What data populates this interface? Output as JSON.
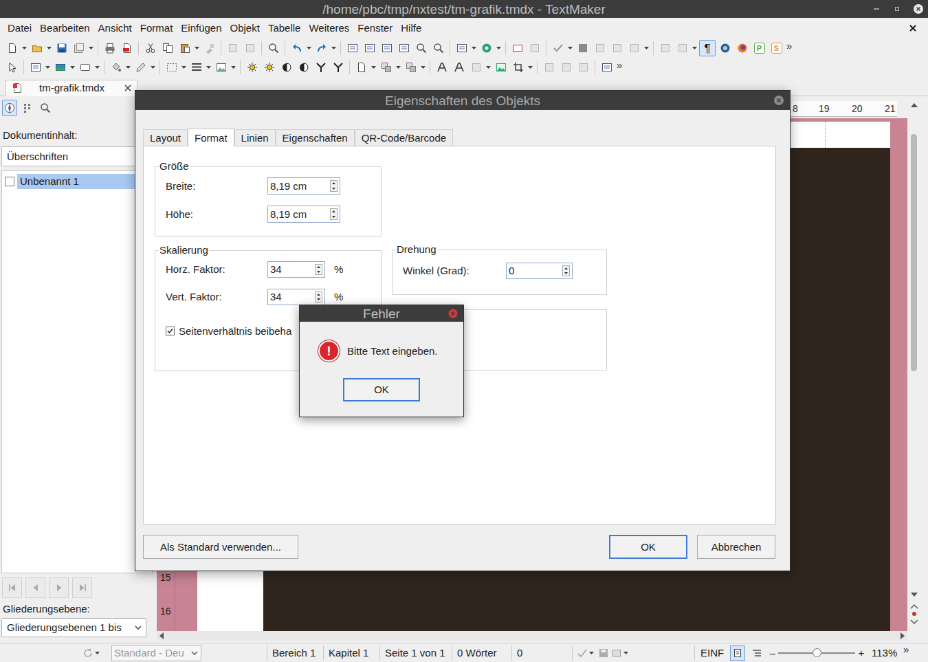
{
  "window": {
    "title": "/home/pbc/tmp/nxtest/tm-grafik.tmdx - TextMaker"
  },
  "menu": {
    "items": [
      "Datei",
      "Bearbeiten",
      "Ansicht",
      "Format",
      "Einfügen",
      "Objekt",
      "Tabelle",
      "Weiteres",
      "Fenster",
      "Hilfe"
    ]
  },
  "toolbar": {
    "pilcrow": {
      "text": "¶",
      "active": true
    },
    "letters": [
      {
        "text": "P",
        "color": "#5aa83c"
      },
      {
        "text": "S",
        "color": "#f0961a"
      }
    ],
    "overflow": "»"
  },
  "toolbar2": {
    "overflow": "»"
  },
  "document_tabs": [
    {
      "label": "tm-grafik.tmdx",
      "selected": true
    }
  ],
  "sidebar": {
    "tabs": [
      {
        "selected": true
      },
      {
        "selected": false
      },
      {
        "selected": false
      }
    ],
    "content_label": "Dokumentinhalt:",
    "filter": "Überschriften",
    "items": [
      {
        "label": "Unbenannt 1",
        "checked": false,
        "selected": true
      }
    ],
    "nav": [
      {
        "disabled": true
      },
      {
        "disabled": true
      },
      {
        "disabled": true
      },
      {
        "disabled": true
      }
    ],
    "outline_label": "Gliederungsebene:",
    "outline_value": "Gliederungsebenen 1 bis"
  },
  "ruler": {
    "top": [
      "8",
      "19",
      "20",
      "21"
    ],
    "left": [
      "15",
      "16"
    ]
  },
  "status_bar": {
    "language": {
      "text": "Standard - Deu",
      "disabled": true
    },
    "cells": [
      "Bereich 1",
      "Kapitel 1",
      "Seite 1 von 1",
      "0 Wörter",
      "0"
    ],
    "mode": "EINF",
    "zoom_out": "–",
    "zoom_level": 0.5,
    "zoom_in": "+",
    "zoom": "113%",
    "overflow": "»"
  },
  "dialog": {
    "title": "Eigenschaften des Objekts",
    "tabs": [
      {
        "label": "Layout",
        "selected": false
      },
      {
        "label": "Format",
        "selected": true
      },
      {
        "label": "Linien",
        "selected": false
      },
      {
        "label": "Eigenschaften",
        "selected": false
      },
      {
        "label": "QR-Code/Barcode",
        "selected": false
      }
    ],
    "groups": [
      {
        "title": "Größe",
        "fields": [
          {
            "label": "Breite:",
            "value": "8,19 cm",
            "unit": ""
          },
          {
            "label": "Höhe:",
            "value": "8,19 cm",
            "unit": ""
          }
        ]
      },
      {
        "title": "Skalierung",
        "fields": [
          {
            "label": "Horz. Faktor:",
            "value": "34",
            "unit": "%"
          },
          {
            "label": "Vert. Faktor:",
            "value": "34",
            "unit": "%"
          }
        ],
        "checkbox": {
          "label": "Seitenverhältnis beibeha",
          "checked": true
        }
      },
      {
        "title": "Drehung",
        "fields": [
          {
            "label": "Winkel (Grad):",
            "value": "0",
            "unit": ""
          }
        ]
      }
    ],
    "buttons": [
      {
        "label": "Als Standard verwenden...",
        "default": false
      },
      {
        "label": "OK",
        "default": true
      },
      {
        "label": "Abbrechen",
        "default": false
      }
    ]
  },
  "error": {
    "title": "Fehler",
    "icon": "!",
    "message": "Bitte Text eingeben.",
    "button": "OK"
  }
}
